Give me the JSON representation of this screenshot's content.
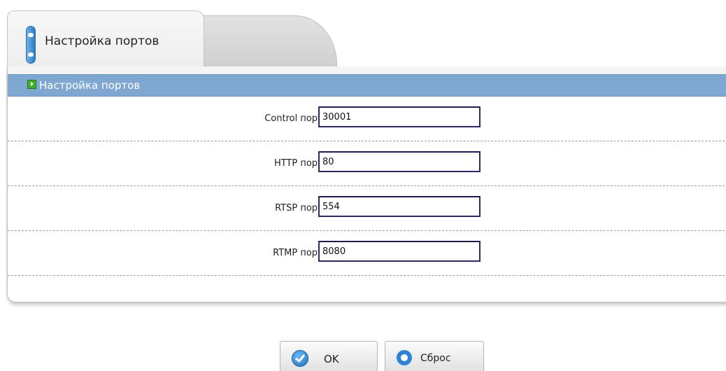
{
  "tabs": [
    {
      "label": "Настройка портов",
      "active": true
    },
    {
      "label": "",
      "active": false
    }
  ],
  "section": {
    "title": "Настройка портов"
  },
  "fields": [
    {
      "label": "Control порт:",
      "value": "30001"
    },
    {
      "label": "HTTP порт:",
      "value": "80"
    },
    {
      "label": "RTSP порт:",
      "value": "554"
    },
    {
      "label": "RTMP порт:",
      "value": "8080"
    }
  ],
  "buttons": {
    "ok_label": "OK",
    "reset_label": "Сброс"
  },
  "icons": {
    "tab": "port-settings-icon",
    "section": "arrow-right-icon",
    "ok": "checkmark-icon",
    "reset": "ring-icon"
  },
  "colors": {
    "header_bar": "#7ea7d1",
    "input_border": "#2a2a6e",
    "accent_blue": "#2b82d6",
    "arrow_green": "#3fae2a"
  }
}
